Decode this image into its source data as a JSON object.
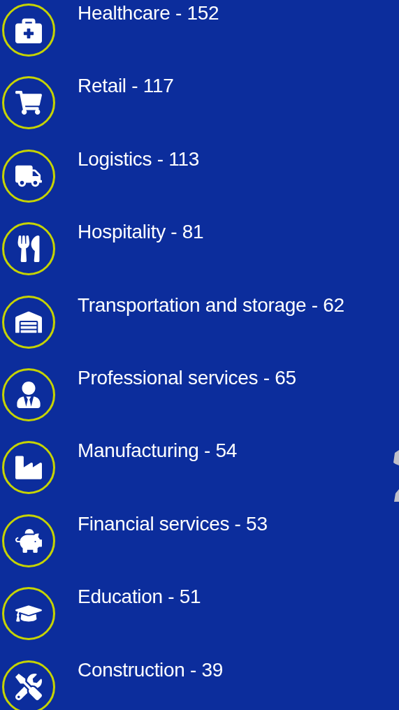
{
  "sectors": [
    {
      "label": "Healthcare - 152"
    },
    {
      "label": "Retail - 117"
    },
    {
      "label": "Logistics - 113"
    },
    {
      "label": "Hospitality - 81"
    },
    {
      "label": "Transportation and storage - 62"
    },
    {
      "label": "Professional services - 65"
    },
    {
      "label": "Manufacturing - 54"
    },
    {
      "label": "Financial services - 53"
    },
    {
      "label": "Education - 51"
    },
    {
      "label": "Construction - 39"
    }
  ]
}
